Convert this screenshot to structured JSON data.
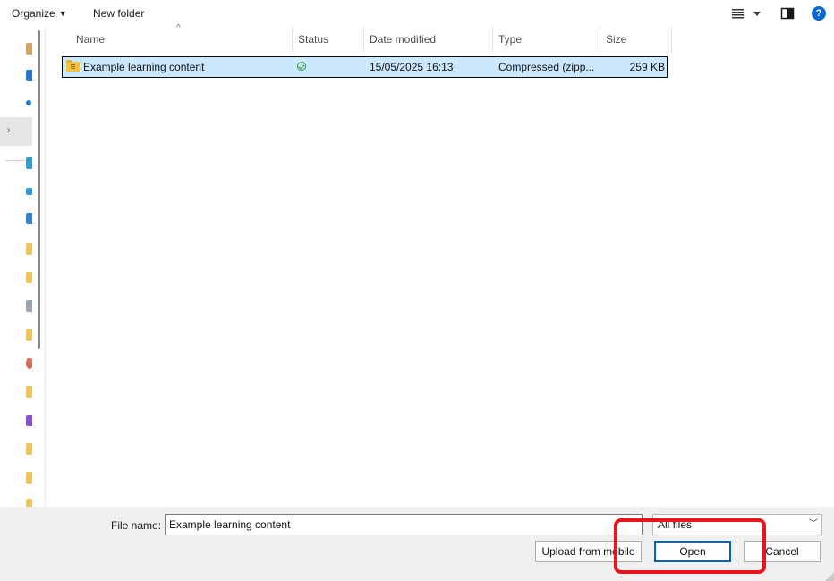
{
  "toolbar": {
    "organize_label": "Organize",
    "new_folder_label": "New folder",
    "help_glyph": "?"
  },
  "columns": {
    "name": "Name",
    "status": "Status",
    "date_modified": "Date modified",
    "type": "Type",
    "size": "Size"
  },
  "files": [
    {
      "name": "Example learning content",
      "status_icon": "synced-check-icon",
      "date_modified": "15/05/2025 16:13",
      "type": "Compressed (zipp...",
      "size": "259 KB",
      "icon": "zip-folder-icon",
      "selected": true
    }
  ],
  "bottom": {
    "file_name_label": "File name:",
    "file_name_value": "Example learning content",
    "file_type_filter": "All files",
    "upload_label": "Upload from mobile",
    "open_label": "Open",
    "cancel_label": "Cancel"
  },
  "colors": {
    "selection": "#cce8ff",
    "highlight": "#e8141b",
    "accent": "#0067c0"
  }
}
